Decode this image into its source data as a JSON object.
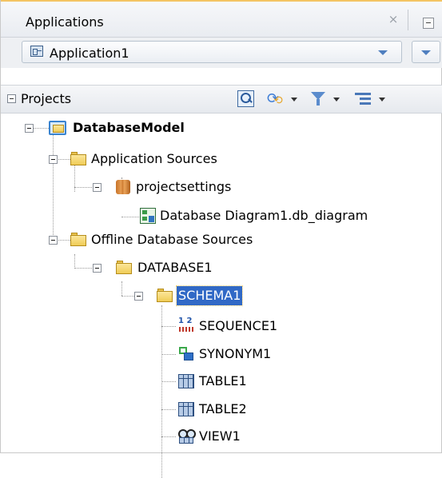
{
  "panel": {
    "title": "Applications",
    "close_glyph": "×",
    "application_selector": {
      "selected": "Application1"
    }
  },
  "projects_bar": {
    "title": "Projects",
    "icons": [
      "search-icon",
      "sync-icon",
      "filter-icon",
      "options-icon"
    ]
  },
  "tree": {
    "root": "DatabaseModel",
    "app_sources": "Application Sources",
    "projectsettings": "projectsettings",
    "diagram": "Database Diagram1.db_diagram",
    "offline_sources": "Offline Database Sources",
    "database": "DATABASE1",
    "schema": "SCHEMA1",
    "items": [
      "SEQUENCE1",
      "SYNONYM1",
      "TABLE1",
      "TABLE2",
      "VIEW1"
    ]
  },
  "colors": {
    "selection": "#3169c6",
    "folder": "#f0cc57",
    "accent_line": "#f4c463"
  }
}
